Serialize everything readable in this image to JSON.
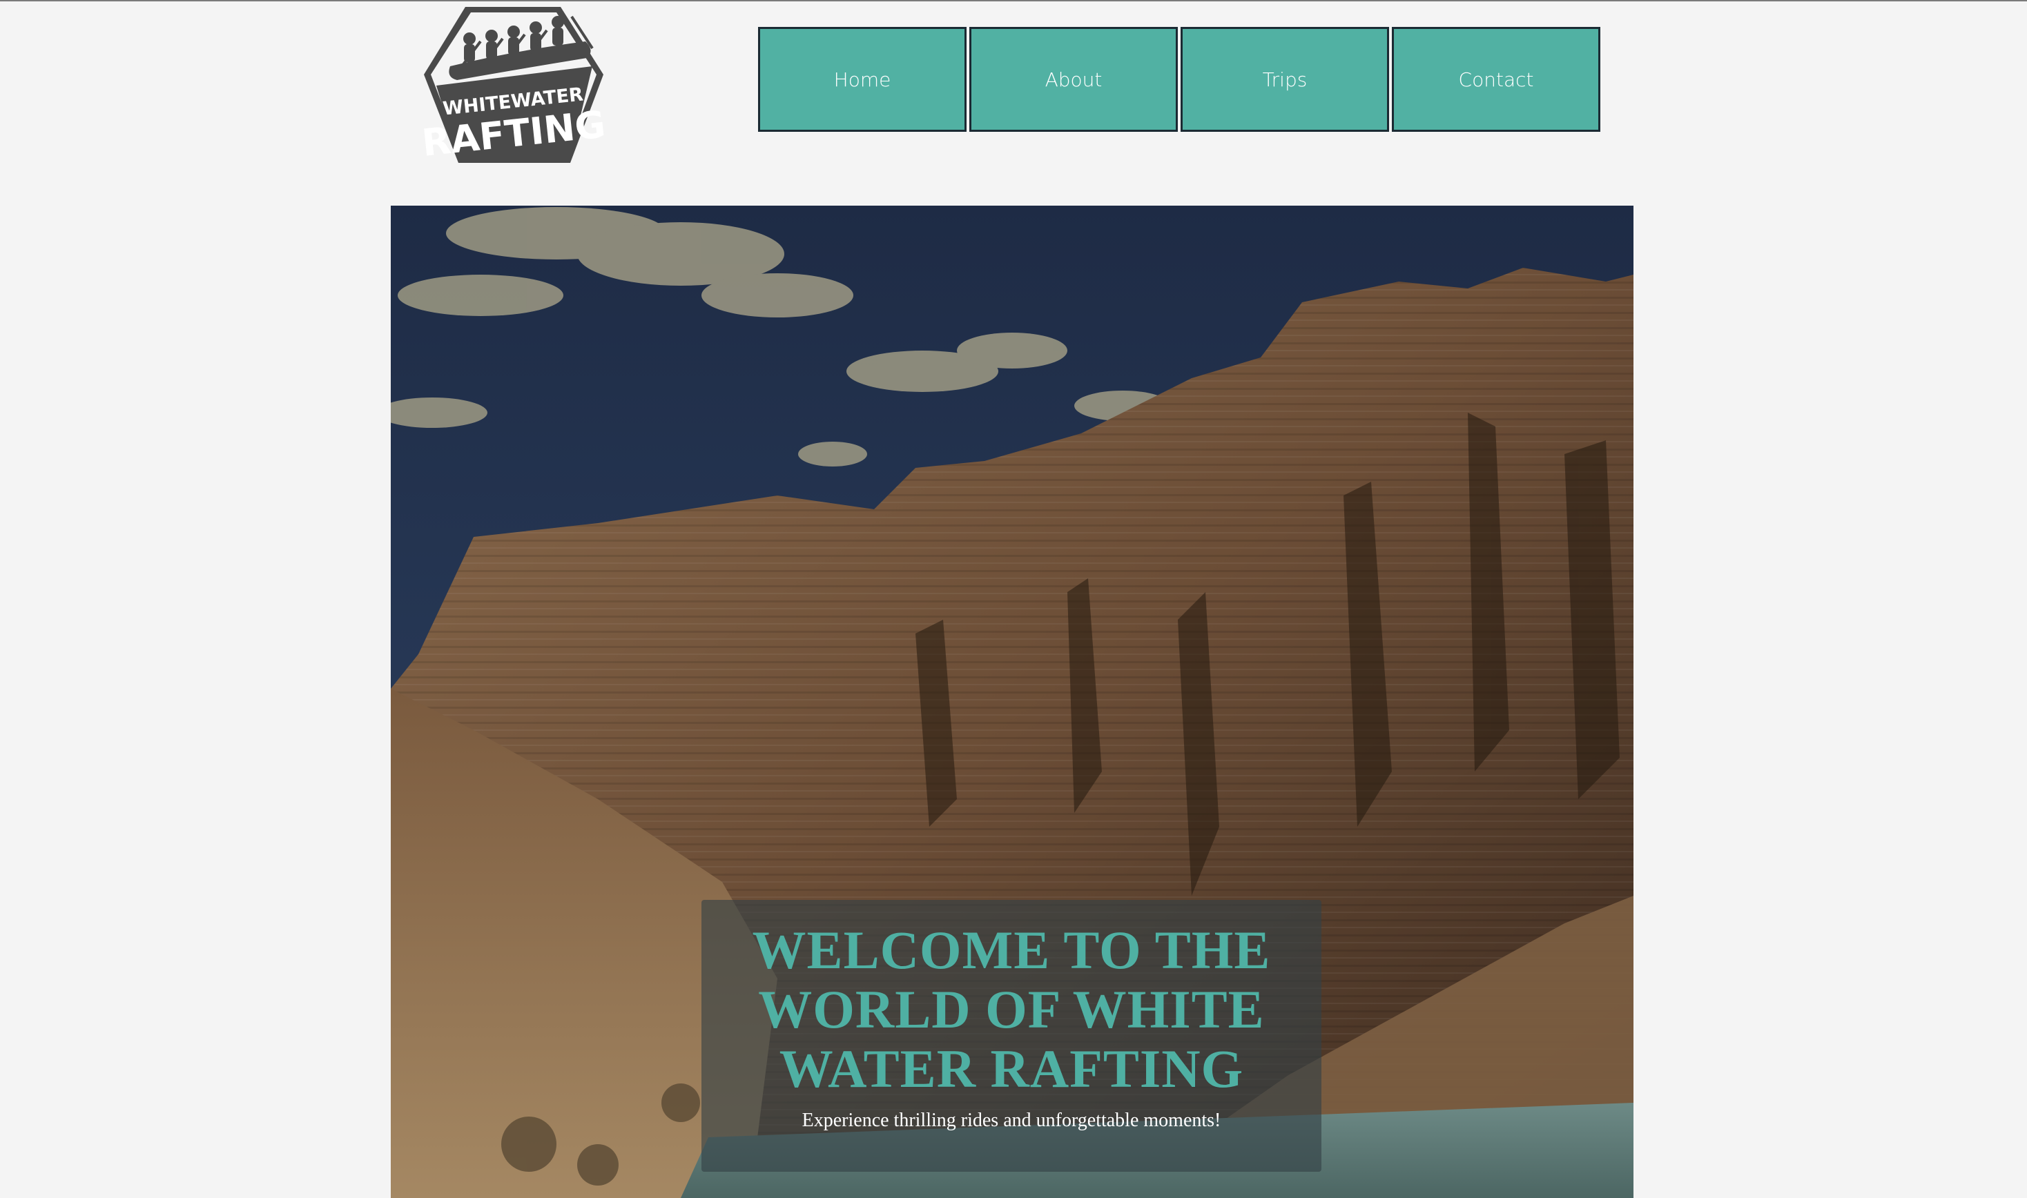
{
  "logo": {
    "line1": "WHITEWATER",
    "line2": "RAFTING",
    "icon": "raft-paddlers-icon",
    "color": "#4a4a4a"
  },
  "nav": {
    "items": [
      {
        "label": "Home"
      },
      {
        "label": "About"
      },
      {
        "label": "Trips"
      },
      {
        "label": "Contact"
      }
    ],
    "accent": "#51b1a3"
  },
  "hero": {
    "image": "canyon-cliffs-river-photo",
    "heading": "WELCOME TO THE WORLD OF WHITE WATER RAFTING",
    "subheading": "Experience thrilling rides and unforgettable moments!",
    "heading_color": "#4fb0a3"
  }
}
